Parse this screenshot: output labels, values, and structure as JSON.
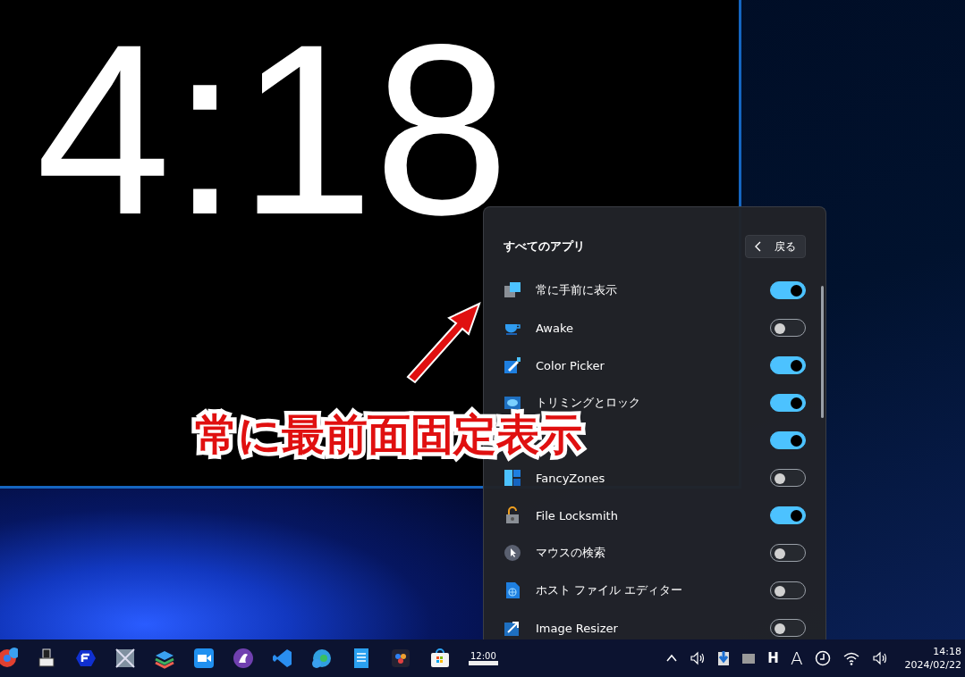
{
  "clock_window": {
    "time": "4:18"
  },
  "flyout": {
    "title": "すべてのアプリ",
    "back_button": {
      "label": "戻る"
    },
    "apps": [
      {
        "label": "常に手前に表示",
        "on": true
      },
      {
        "label": "Awake",
        "on": false
      },
      {
        "label": "Color Picker",
        "on": true
      },
      {
        "label": "トリミングとロック",
        "on": true
      },
      {
        "on": true
      },
      {
        "label": "FancyZones",
        "on": false
      },
      {
        "label": "File Locksmith",
        "on": true
      },
      {
        "label": "マウスの検索",
        "on": false
      },
      {
        "label": "ホスト ファイル エディター",
        "on": false
      },
      {
        "label": "Image Resizer",
        "on": false
      }
    ]
  },
  "annotation": {
    "text": "常に最前面固定表示"
  },
  "taskbar": {
    "clock_app_label": "12:00",
    "ime_mode": "H",
    "font_indicator": "A",
    "time": "14:18",
    "date": "2024/02/22"
  }
}
